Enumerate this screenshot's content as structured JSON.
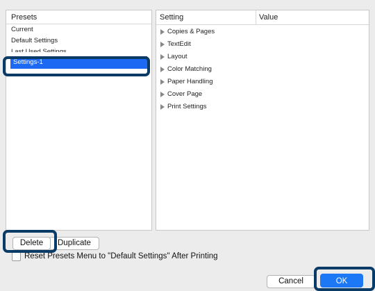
{
  "presets": {
    "header": "Presets",
    "items": [
      "Current",
      "Default Settings",
      "Last Used Settings",
      "Settings-1"
    ],
    "selected": "Settings-1"
  },
  "settings": {
    "header_setting": "Setting",
    "header_value": "Value",
    "items": [
      "Copies & Pages",
      "TextEdit",
      "Layout",
      "Color Matching",
      "Paper Handling",
      "Cover Page",
      "Print Settings"
    ]
  },
  "buttons": {
    "delete": "Delete",
    "duplicate": "Duplicate",
    "cancel": "Cancel",
    "ok": "OK"
  },
  "reset_checkbox": {
    "label": "Reset Presets Menu to \"Default Settings\" After Printing",
    "checked": false
  },
  "colors": {
    "accent": "#1d78f5",
    "highlight_frame": "#0a3b66"
  }
}
